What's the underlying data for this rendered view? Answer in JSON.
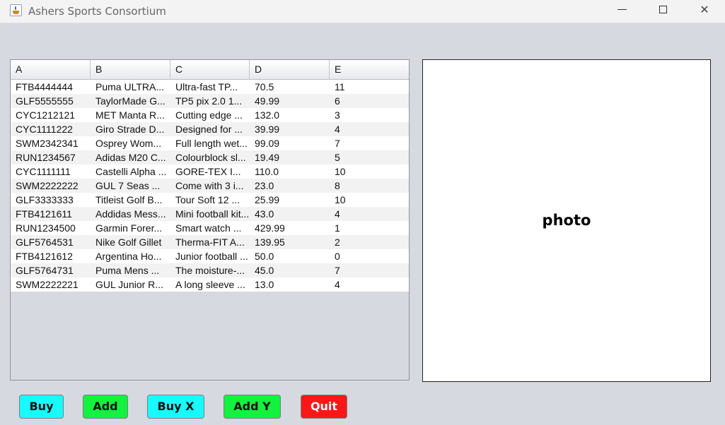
{
  "window": {
    "title": "Ashers Sports Consortium",
    "controls": {
      "minimize": "—",
      "maximize": "☐",
      "close": "✕"
    }
  },
  "table": {
    "columns": [
      "A",
      "B",
      "C",
      "D",
      "E"
    ],
    "rows": [
      [
        "FTB4444444",
        "Puma ULTRA...",
        "Ultra-fast TP...",
        "70.5",
        "11"
      ],
      [
        "GLF5555555",
        "TaylorMade G...",
        "TP5 pix 2.0 1...",
        "49.99",
        "6"
      ],
      [
        "CYC1212121",
        "MET Manta R...",
        "Cutting edge ...",
        "132.0",
        "3"
      ],
      [
        "CYC1111222",
        "Giro Strade D...",
        "Designed for ...",
        "39.99",
        "4"
      ],
      [
        "SWM2342341",
        "Osprey Wom...",
        "Full length wet...",
        "99.09",
        "7"
      ],
      [
        "RUN1234567",
        "Adidas M20 C...",
        "Colourblock sl...",
        "19.49",
        "5"
      ],
      [
        "CYC1111111",
        "Castelli Alpha ...",
        "GORE-TEX I...",
        "110.0",
        "10"
      ],
      [
        "SWM2222222",
        "GUL 7 Seas ...",
        "Come with 3 i...",
        "23.0",
        "8"
      ],
      [
        "GLF3333333",
        "Titleist Golf B...",
        "Tour Soft 12 ...",
        "25.99",
        "10"
      ],
      [
        "FTB4121611",
        "Addidas Mess...",
        "Mini football kit...",
        "43.0",
        "4"
      ],
      [
        "RUN1234500",
        "Garmin Forer...",
        "Smart watch ...",
        "429.99",
        "1"
      ],
      [
        "GLF5764531",
        "Nike Golf Gillet",
        "Therma-FIT A...",
        "139.95",
        "2"
      ],
      [
        "FTB4121612",
        "Argentina Ho...",
        "Junior football ...",
        "50.0",
        "0"
      ],
      [
        "GLF5764731",
        "Puma Mens ...",
        "The moisture-...",
        "45.0",
        "7"
      ],
      [
        "SWM2222221",
        "GUL Junior R...",
        "A long sleeve ...",
        "13.0",
        "4"
      ]
    ]
  },
  "photo": {
    "label": "photo"
  },
  "buttons": {
    "buy": "Buy",
    "add": "Add",
    "buy_x": "Buy X",
    "add_y": "Add Y",
    "quit": "Quit"
  },
  "colors": {
    "buy": "#17fbff",
    "add": "#12f23e",
    "quit": "#ff1616",
    "window_bg": "#d6d9e0"
  }
}
